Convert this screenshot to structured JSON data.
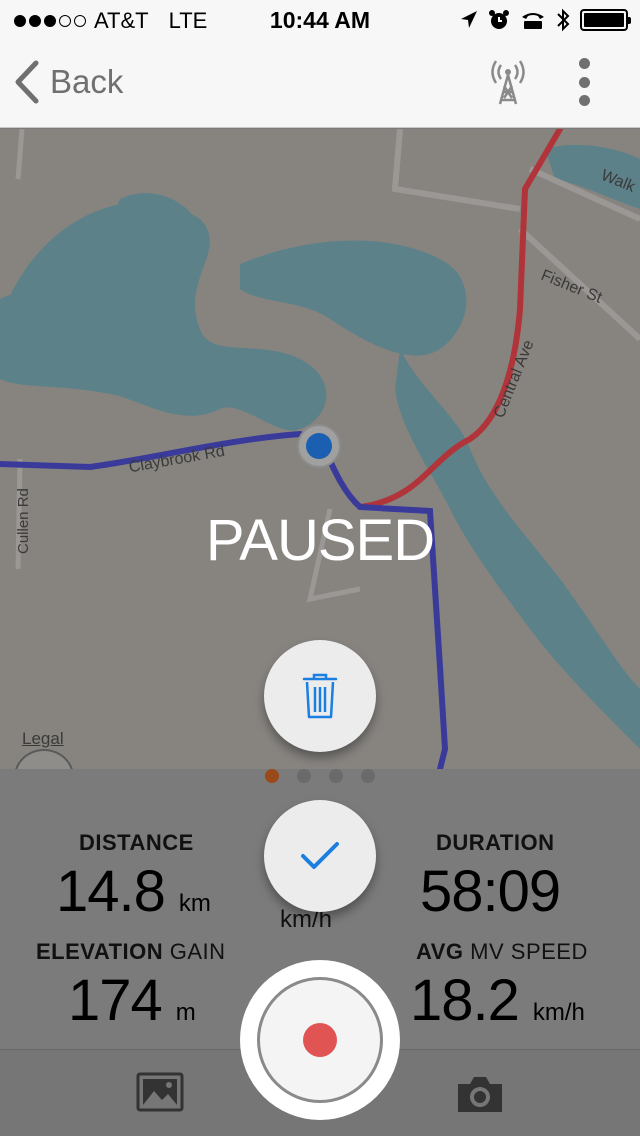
{
  "status_bar": {
    "carrier": "AT&T",
    "network": "LTE",
    "time": "10:44 AM"
  },
  "nav": {
    "back_label": "Back"
  },
  "map": {
    "street_labels": [
      "Claybrook Rd",
      "Cullen Rd",
      "Central Ave",
      "Fisher St",
      "Walk"
    ],
    "overlay_status": "PAUSED",
    "legal_label": "Legal"
  },
  "stats": {
    "distance": {
      "label": "DISTANCE",
      "value": "14.8",
      "unit": "km"
    },
    "duration": {
      "label": "DURATION",
      "value": "58:09"
    },
    "elevation": {
      "label_bold": "ELEVATION",
      "label_regular": "GAIN",
      "value": "174",
      "unit": "m"
    },
    "avg_speed": {
      "label_bold": "AVG",
      "label_regular": "MV SPEED",
      "value": "18.2",
      "unit": "km/h"
    },
    "center_unit": "km/h",
    "pages": 4,
    "active_page": 1
  },
  "colors": {
    "accent_blue": "#1a7fe0",
    "record_red": "#e05454",
    "route_red": "#b0343a",
    "route_blue": "#3a3a9a",
    "water": "#5d8189",
    "land": "#878480"
  },
  "icons": {
    "delete": "trash-icon",
    "save": "checkmark-icon",
    "gallery": "photo-icon",
    "camera": "camera-icon",
    "record": "record-icon",
    "sensors": "antenna-icon",
    "more": "more-vertical-icon"
  }
}
